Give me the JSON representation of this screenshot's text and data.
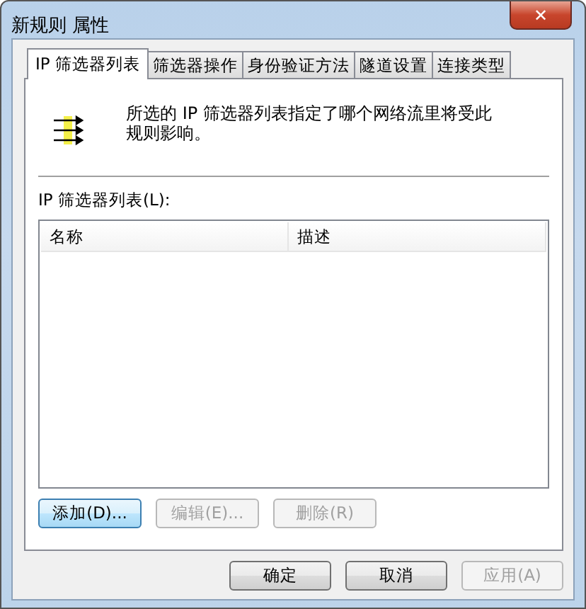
{
  "window": {
    "title": "新规则 属性",
    "close": "✕"
  },
  "tabs": [
    {
      "label": "IP 筛选器列表",
      "selected": true
    },
    {
      "label": "筛选器操作",
      "selected": false
    },
    {
      "label": "身份验证方法",
      "selected": false
    },
    {
      "label": "隧道设置",
      "selected": false
    },
    {
      "label": "连接类型",
      "selected": false
    }
  ],
  "description": "所选的 IP 筛选器列表指定了哪个网络流里将受此规则影响。",
  "list": {
    "label": "IP 筛选器列表(L):",
    "columns": [
      "名称",
      "描述"
    ]
  },
  "list_buttons": [
    {
      "label": "添加(D)...",
      "disabled": false
    },
    {
      "label": "编辑(E)...",
      "disabled": true
    },
    {
      "label": "删除(R)",
      "disabled": true
    }
  ],
  "dialog_buttons": [
    {
      "label": "确定",
      "disabled": false
    },
    {
      "label": "取消",
      "disabled": false
    },
    {
      "label": "应用(A)",
      "disabled": true
    }
  ]
}
